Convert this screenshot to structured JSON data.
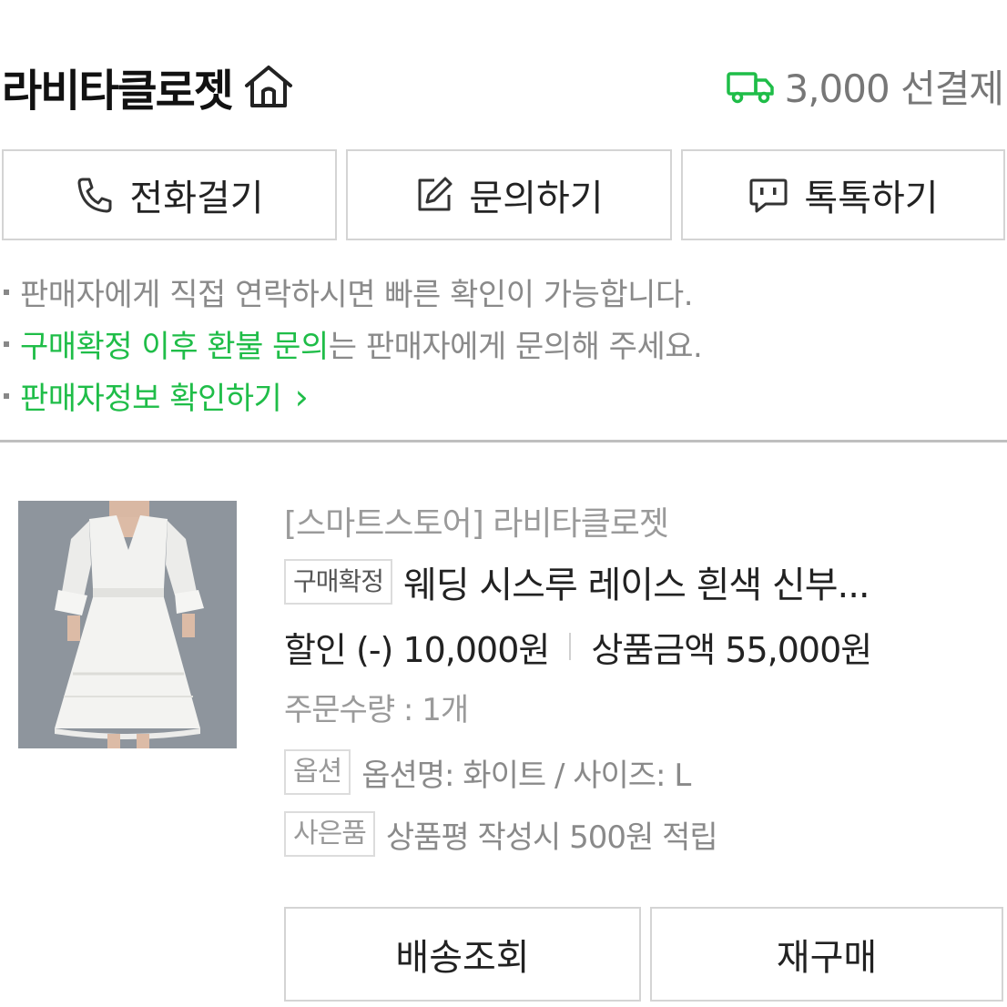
{
  "header": {
    "shop_name": "라비타클로젯",
    "home_icon": "home-icon",
    "shipping_icon": "truck-icon",
    "shipping_text": "3,000 선결제",
    "accent_color": "#1fbd48"
  },
  "contact_buttons": [
    {
      "label": "전화걸기",
      "icon": "phone-icon"
    },
    {
      "label": "문의하기",
      "icon": "edit-icon"
    },
    {
      "label": "톡톡하기",
      "icon": "chat-icon"
    }
  ],
  "notices": {
    "line1": "판매자에게 직접 연락하시면 빠른 확인이 가능합니다.",
    "line2_highlight": "구매확정 이후 환불 문의",
    "line2_rest": "는 판매자에게 문의해 주세요.",
    "line3_link": "판매자정보 확인하기",
    "line3_arrow": "›"
  },
  "product": {
    "store_label": "[스마트스토어] 라비타클로젯",
    "status_badge": "구매확정",
    "title": "웨딩 시스루 레이스 흰색 신부...",
    "discount_text": "할인 (-) 10,000원",
    "amount_text": "상품금액 55,000원",
    "quantity_text": "주문수량 : 1개",
    "option_badge": "옵션",
    "option_text": "옵션명: 화이트 / 사이즈: L",
    "gift_badge": "사은품",
    "gift_text": "상품평 작성시 500원 적립"
  },
  "actions": {
    "track_label": "배송조회",
    "reorder_label": "재구매"
  }
}
